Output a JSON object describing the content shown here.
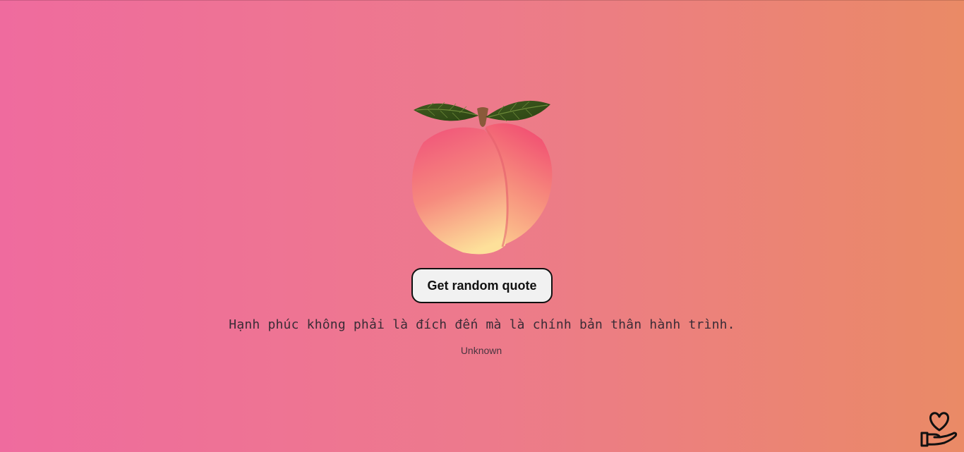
{
  "button": {
    "label": "Get random quote"
  },
  "quote": {
    "text": "Hạnh phúc không phải là đích đến mà là chính bản thân hành trình.",
    "author": "Unknown"
  },
  "icons": {
    "illustration": "peach-icon",
    "corner": "hand-heart-icon"
  },
  "colors": {
    "background_left": "#ef6b9e",
    "background_right": "#ea8a66",
    "button_bg": "#f1f1f1",
    "button_border": "#111111"
  }
}
